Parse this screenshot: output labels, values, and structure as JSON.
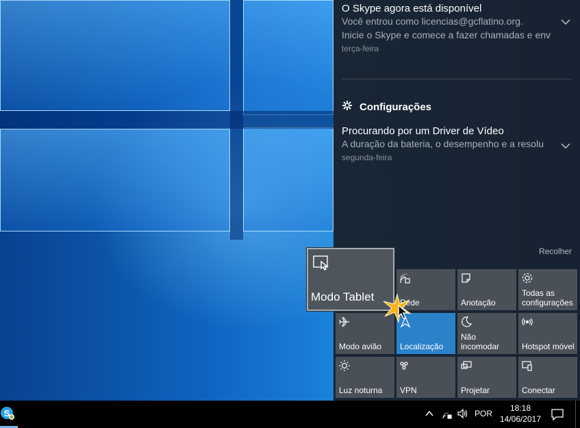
{
  "notifications": {
    "skype": {
      "title": "O Skype agora está disponível",
      "line1": "Você entrou como licencias@gcflatino.org.",
      "line2": "Inicie o Skype e comece a fazer chamadas e env",
      "time": "terça-feira"
    },
    "group_title": "Configurações",
    "driver": {
      "title": "Procurando por um Driver de Vídeo",
      "body": "A duração da bateria, o desempenho e a resolu",
      "time": "segunda-feira"
    },
    "collapse_label": "Recolher"
  },
  "tooltip": {
    "label": "Modo Tablet"
  },
  "quick_actions": [
    {
      "label": "Rede",
      "icon": "network-icon",
      "active": false
    },
    {
      "label": "Anotação",
      "icon": "note-icon",
      "active": false
    },
    {
      "label": "Todas as configurações",
      "icon": "gear-icon",
      "active": false
    },
    {
      "label": "Modo avião",
      "icon": "airplane-icon",
      "active": false
    },
    {
      "label": "Localização",
      "icon": "location-icon",
      "active": true
    },
    {
      "label": "Não incomodar",
      "icon": "moon-icon",
      "active": false
    },
    {
      "label": "Hotspot móvel",
      "icon": "hotspot-icon",
      "active": false
    },
    {
      "label": "Luz noturna",
      "icon": "sun-icon",
      "active": false
    },
    {
      "label": "VPN",
      "icon": "vpn-icon",
      "active": false
    },
    {
      "label": "Projetar",
      "icon": "project-icon",
      "active": false
    },
    {
      "label": "Conectar",
      "icon": "connect-icon",
      "active": false
    }
  ],
  "taskbar": {
    "language": "POR",
    "time": "18:18",
    "date": "14/06/2017"
  },
  "colors": {
    "accent": "#2c82c9",
    "tile": "#4a5057",
    "panel": "#18202a"
  }
}
